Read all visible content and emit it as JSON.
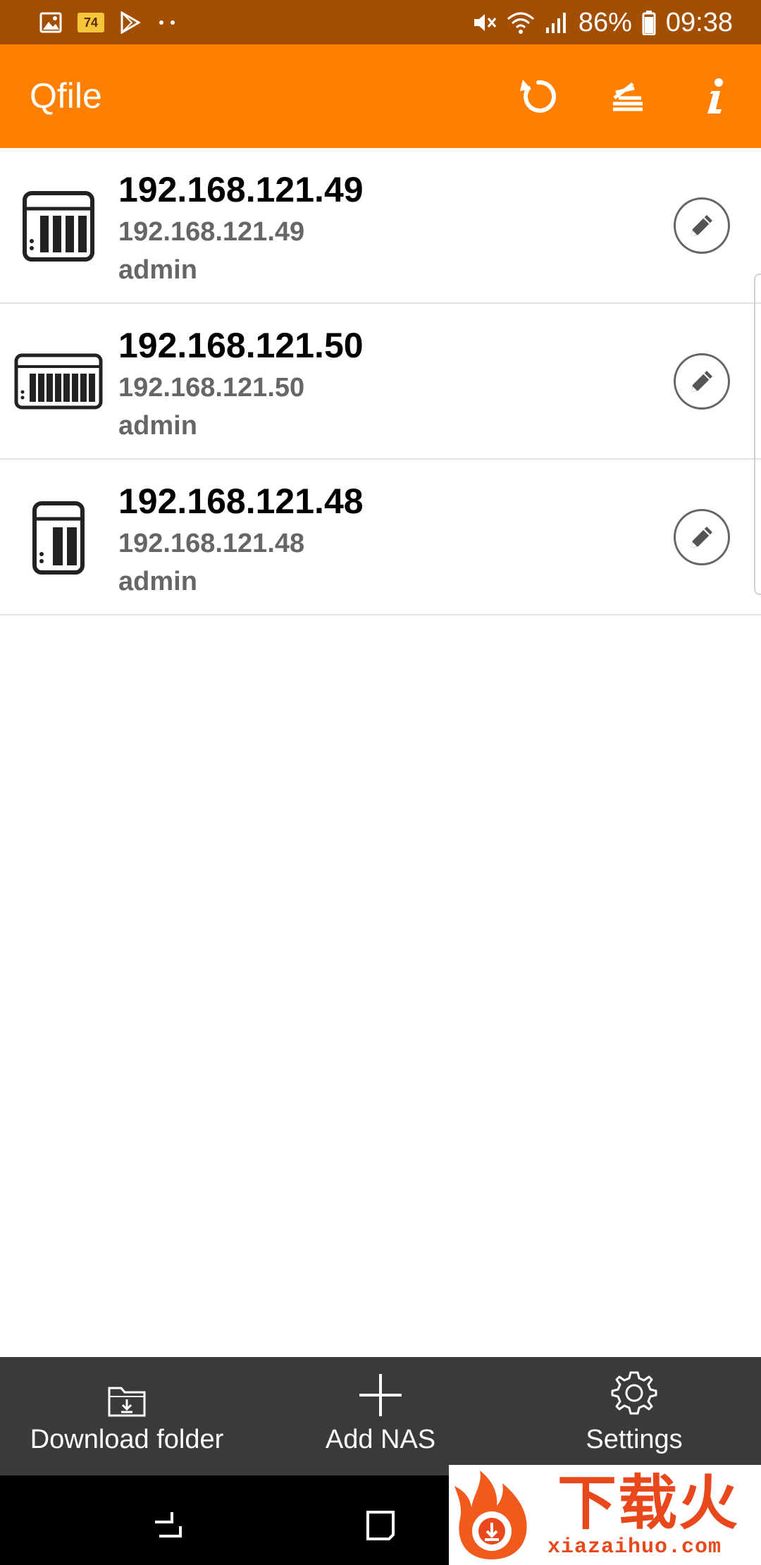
{
  "status_bar": {
    "notification_badge": "74",
    "battery": "86%",
    "time": "09:38",
    "icons": [
      "gallery-icon",
      "badge-icon",
      "play-store-icon",
      "more-dots-icon",
      "mute-icon",
      "wifi-icon",
      "signal-icon",
      "battery-icon"
    ]
  },
  "app_bar": {
    "title": "Qfile",
    "background": "#ff8000",
    "actions": [
      "refresh-icon",
      "sort-stack-icon",
      "info-icon"
    ]
  },
  "nas_list": [
    {
      "name": "192.168.121.49",
      "address": "192.168.121.49",
      "user": "admin",
      "model_icon": "nas-4bay-icon"
    },
    {
      "name": "192.168.121.50",
      "address": "192.168.121.50",
      "user": "admin",
      "model_icon": "nas-rack-icon"
    },
    {
      "name": "192.168.121.48",
      "address": "192.168.121.48",
      "user": "admin",
      "model_icon": "nas-2bay-icon"
    }
  ],
  "bottom_bar": {
    "download_folder": "Download folder",
    "add_nas": "Add NAS",
    "settings": "Settings"
  },
  "watermark": {
    "brand": "下载火",
    "url": "xiazaihuo.com"
  }
}
